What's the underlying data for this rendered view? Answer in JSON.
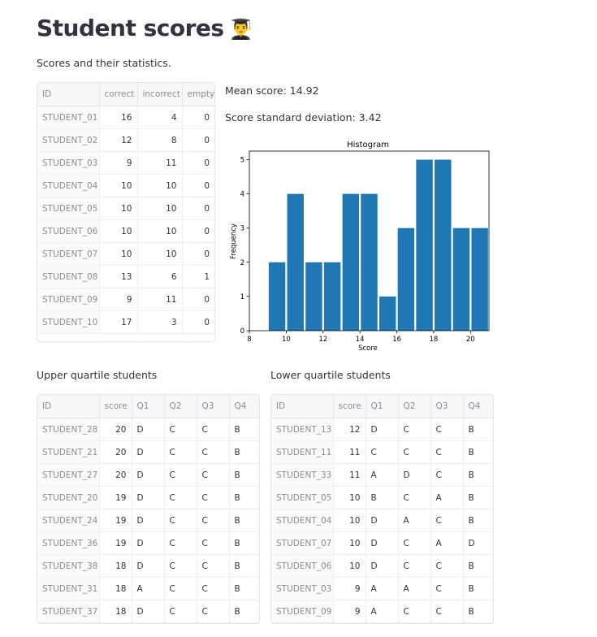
{
  "header": {
    "title": "Student scores",
    "title_emoji": "👨‍🎓",
    "subtitle": "Scores and their statistics."
  },
  "stats": {
    "mean": "Mean score: 14.92",
    "std": "Score standard deviation: 3.42"
  },
  "scores_table": {
    "columns": [
      "ID",
      "correct",
      "incorrect",
      "empty"
    ],
    "rows": [
      [
        "STUDENT_01",
        "16",
        "4",
        "0"
      ],
      [
        "STUDENT_02",
        "12",
        "8",
        "0"
      ],
      [
        "STUDENT_03",
        "9",
        "11",
        "0"
      ],
      [
        "STUDENT_04",
        "10",
        "10",
        "0"
      ],
      [
        "STUDENT_05",
        "10",
        "10",
        "0"
      ],
      [
        "STUDENT_06",
        "10",
        "10",
        "0"
      ],
      [
        "STUDENT_07",
        "10",
        "10",
        "0"
      ],
      [
        "STUDENT_08",
        "13",
        "6",
        "1"
      ],
      [
        "STUDENT_09",
        "9",
        "11",
        "0"
      ],
      [
        "STUDENT_10",
        "17",
        "3",
        "0"
      ]
    ]
  },
  "upper": {
    "heading": "Upper quartile students",
    "columns": [
      "ID",
      "score",
      "Q1",
      "Q2",
      "Q3",
      "Q4"
    ],
    "rows": [
      [
        "STUDENT_28",
        "20",
        "D",
        "C",
        "C",
        "B"
      ],
      [
        "STUDENT_21",
        "20",
        "D",
        "C",
        "C",
        "B"
      ],
      [
        "STUDENT_27",
        "20",
        "D",
        "C",
        "C",
        "B"
      ],
      [
        "STUDENT_20",
        "19",
        "D",
        "C",
        "C",
        "B"
      ],
      [
        "STUDENT_24",
        "19",
        "D",
        "C",
        "C",
        "B"
      ],
      [
        "STUDENT_36",
        "19",
        "D",
        "C",
        "C",
        "B"
      ],
      [
        "STUDENT_38",
        "18",
        "D",
        "C",
        "C",
        "B"
      ],
      [
        "STUDENT_31",
        "18",
        "A",
        "C",
        "C",
        "B"
      ],
      [
        "STUDENT_37",
        "18",
        "D",
        "C",
        "C",
        "B"
      ]
    ]
  },
  "lower": {
    "heading": "Lower quartile students",
    "columns": [
      "ID",
      "score",
      "Q1",
      "Q2",
      "Q3",
      "Q4"
    ],
    "rows": [
      [
        "STUDENT_13",
        "12",
        "D",
        "C",
        "C",
        "B"
      ],
      [
        "STUDENT_11",
        "11",
        "C",
        "C",
        "C",
        "B"
      ],
      [
        "STUDENT_33",
        "11",
        "A",
        "D",
        "C",
        "B"
      ],
      [
        "STUDENT_05",
        "10",
        "B",
        "C",
        "A",
        "B"
      ],
      [
        "STUDENT_04",
        "10",
        "D",
        "A",
        "C",
        "B"
      ],
      [
        "STUDENT_07",
        "10",
        "D",
        "C",
        "A",
        "D"
      ],
      [
        "STUDENT_06",
        "10",
        "D",
        "C",
        "C",
        "B"
      ],
      [
        "STUDENT_03",
        "9",
        "A",
        "A",
        "C",
        "B"
      ],
      [
        "STUDENT_09",
        "9",
        "A",
        "C",
        "C",
        "B"
      ]
    ]
  },
  "chart_data": {
    "type": "bar",
    "title": "Histogram",
    "xlabel": "Score",
    "ylabel": "Frequency",
    "bins": [
      [
        9,
        10
      ],
      [
        10,
        11
      ],
      [
        11,
        12
      ],
      [
        12,
        13
      ],
      [
        13,
        14
      ],
      [
        14,
        15
      ],
      [
        15,
        16
      ],
      [
        16,
        17
      ],
      [
        17,
        18
      ],
      [
        18,
        19
      ],
      [
        19,
        20
      ],
      [
        20,
        21
      ]
    ],
    "bin_centers": [
      9.5,
      10.5,
      11.5,
      12.5,
      13.5,
      14.5,
      15.5,
      16.5,
      17.5,
      18.5,
      19.5,
      20.5
    ],
    "values": [
      2,
      4,
      2,
      2,
      4,
      4,
      1,
      3,
      5,
      5,
      3,
      3
    ],
    "xlim": [
      8,
      21
    ],
    "ylim": [
      0,
      5.25
    ],
    "xticks": [
      "8",
      "10",
      "12",
      "14",
      "16",
      "18",
      "20"
    ],
    "yticks": [
      "0",
      "1",
      "2",
      "3",
      "4",
      "5"
    ],
    "color": "#1f77b4",
    "grid": false
  }
}
